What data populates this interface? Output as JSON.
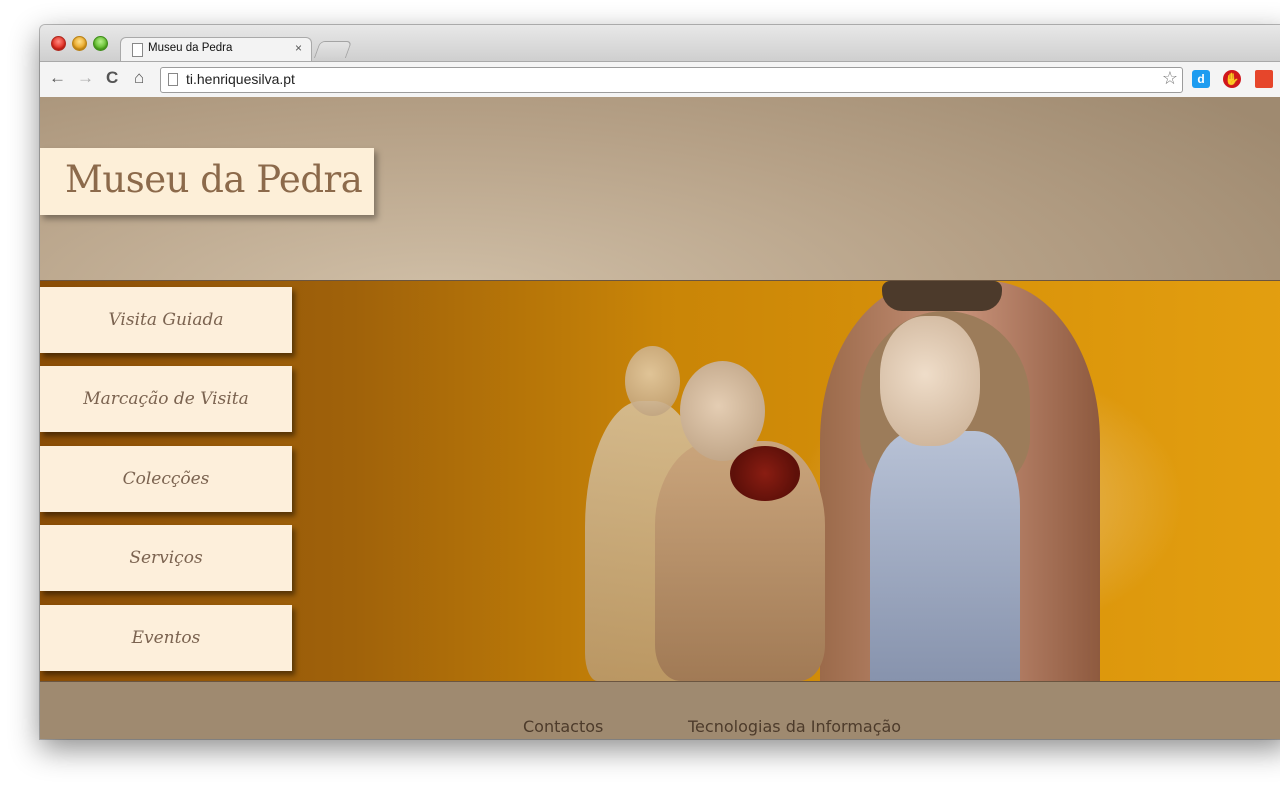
{
  "browser": {
    "tab_title": "Museu da Pedra",
    "tab_close": "×",
    "url": "ti.henriquesilva.pt",
    "buttons": {
      "back": "←",
      "forward": "→",
      "reload": "C",
      "home": "⌂",
      "star": "☆"
    },
    "extensions": {
      "d": "d",
      "stop": "✋",
      "last": ""
    }
  },
  "site": {
    "title": "Museu da Pedra",
    "nav": [
      "Visita Guiada",
      "Marcação de Visita",
      "Colecções",
      "Serviços",
      "Eventos"
    ],
    "footer_links": [
      "Contactos",
      "Tecnologias da Informação"
    ]
  },
  "colors": {
    "logo_background": "#fdefd8",
    "nav_background": "#fdefdb",
    "header_background": "#b6a187",
    "hero_background": "#c98507"
  }
}
